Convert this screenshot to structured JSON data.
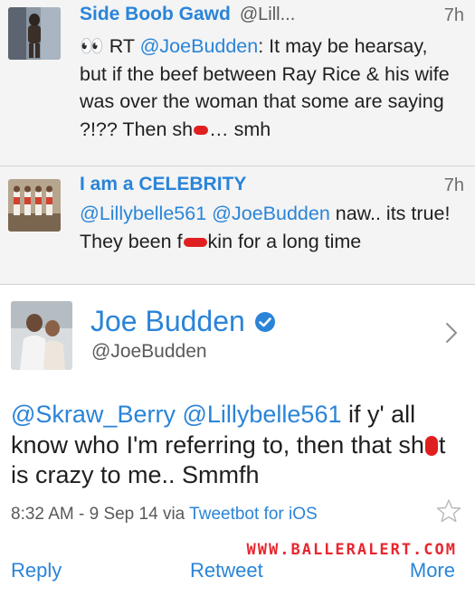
{
  "replies": [
    {
      "name": "Side Boob Gawd",
      "handle": "@Lill...",
      "time": "7h",
      "text_1": "👀 RT ",
      "mention_1": "@JoeBudden",
      "text_2": ": It may be hearsay, but if the beef between Ray Rice & his wife was over the woman that some are saying ?!?? Then sh",
      "text_3": "… smh"
    },
    {
      "name": "I am a CELEBRITY",
      "time": "7h",
      "mention_1": "@Lillybelle561",
      "mention_2": "@JoeBudden",
      "text_1": " naw.. its true! They been f",
      "text_2": "kin for a long time"
    }
  ],
  "profile": {
    "name": "Joe Budden",
    "handle": "@JoeBudden"
  },
  "main_tweet": {
    "mention_1": "@Skraw_Berry",
    "mention_2": "@Lillybelle561",
    "text_1": " if y' all know who I'm referring to, then that sh",
    "text_2": "t is crazy to me.. Smmfh",
    "timestamp": "8:32 AM - 9 Sep 14 via ",
    "client": "Tweetbot for iOS"
  },
  "watermark": "WWW.BALLERALERT.COM",
  "actions": {
    "reply": "Reply",
    "retweet": "Retweet",
    "more": "More"
  },
  "colors": {
    "link_blue": "#2a84d8",
    "censor_red": "#e02020",
    "watermark_red": "#e8262f"
  },
  "icons": [
    "verified-badge-icon",
    "chevron-right-icon",
    "star-icon"
  ]
}
